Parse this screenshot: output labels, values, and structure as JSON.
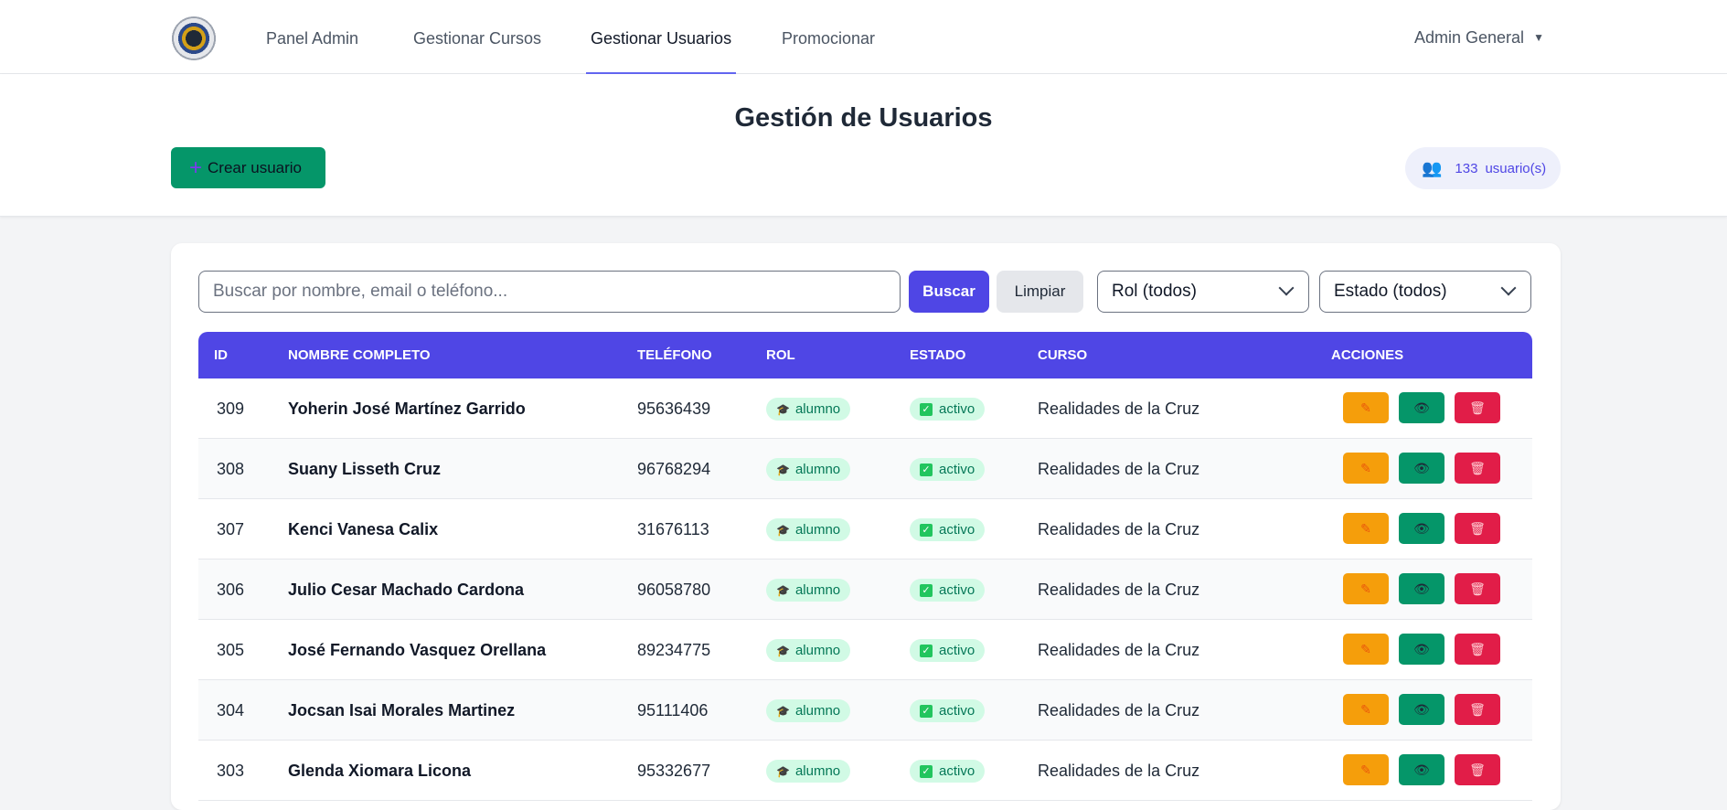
{
  "nav": {
    "items": [
      {
        "label": "Panel Admin",
        "active": false
      },
      {
        "label": "Gestionar Cursos",
        "active": false
      },
      {
        "label": "Gestionar Usuarios",
        "active": true
      },
      {
        "label": "Promocionar",
        "active": false
      }
    ],
    "user_label": "Admin General"
  },
  "header": {
    "title": "Gestión de Usuarios",
    "create_label": "Crear usuario",
    "count": "133",
    "count_suffix": "usuario(s)"
  },
  "filters": {
    "search_placeholder": "Buscar por nombre, email o teléfono...",
    "search_value": "",
    "search_button": "Buscar",
    "clear_button": "Limpiar",
    "role_selected": "Rol (todos)",
    "status_selected": "Estado (todos)"
  },
  "table": {
    "headers": {
      "id": "ID",
      "name": "Nombre completo",
      "phone": "Teléfono",
      "role": "Rol",
      "status": "Estado",
      "course": "Curso",
      "actions": "Acciones"
    },
    "rows": [
      {
        "id": "309",
        "name": "Yoherin José Martínez Garrido",
        "phone": "95636439",
        "role": "alumno",
        "status": "activo",
        "course": "Realidades de la Cruz"
      },
      {
        "id": "308",
        "name": "Suany Lisseth Cruz",
        "phone": "96768294",
        "role": "alumno",
        "status": "activo",
        "course": "Realidades de la Cruz"
      },
      {
        "id": "307",
        "name": "Kenci Vanesa Calix",
        "phone": "31676113",
        "role": "alumno",
        "status": "activo",
        "course": "Realidades de la Cruz"
      },
      {
        "id": "306",
        "name": "Julio Cesar Machado Cardona",
        "phone": "96058780",
        "role": "alumno",
        "status": "activo",
        "course": "Realidades de la Cruz"
      },
      {
        "id": "305",
        "name": "José Fernando Vasquez Orellana",
        "phone": "89234775",
        "role": "alumno",
        "status": "activo",
        "course": "Realidades de la Cruz"
      },
      {
        "id": "304",
        "name": "Jocsan Isai Morales Martinez",
        "phone": "95111406",
        "role": "alumno",
        "status": "activo",
        "course": "Realidades de la Cruz"
      },
      {
        "id": "303",
        "name": "Glenda Xiomara Licona",
        "phone": "95332677",
        "role": "alumno",
        "status": "activo",
        "course": "Realidades de la Cruz"
      }
    ]
  },
  "colors": {
    "primary": "#4f46e5",
    "success": "#059669",
    "warning": "#f59e0b",
    "danger": "#e11d48"
  },
  "icons": {
    "role": "graduation-cap-icon",
    "status": "check-box-icon",
    "edit": "pencil-icon",
    "view": "eye-icon",
    "delete": "trash-icon",
    "users": "users-icon"
  }
}
